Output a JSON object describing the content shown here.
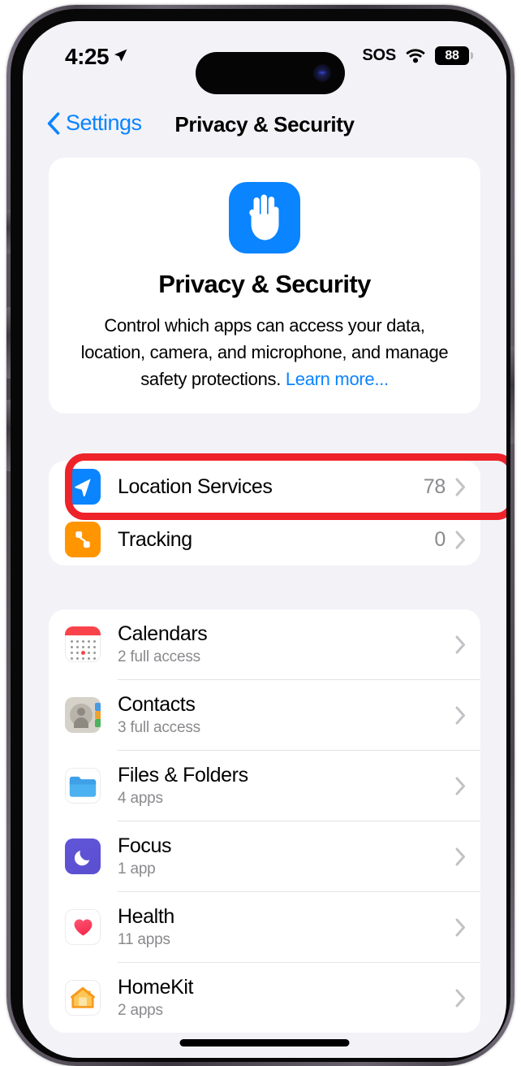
{
  "status_bar": {
    "time": "4:25",
    "location_icon": "location-arrow-icon",
    "sos": "SOS",
    "wifi_icon": "wifi-icon",
    "battery_percent": "88"
  },
  "nav": {
    "back_label": "Settings",
    "back_icon": "chevron-left-icon",
    "title": "Privacy & Security"
  },
  "hero": {
    "icon": "privacy-hand-icon",
    "icon_color": "#0a84ff",
    "title": "Privacy & Security",
    "description": "Control which apps can access your data, location, camera, and microphone, and manage safety protections. ",
    "link_label": "Learn more...",
    "link_color": "#0a84ff"
  },
  "location_section": {
    "rows": [
      {
        "label": "Location Services",
        "value": "78",
        "icon": "location-arrow-icon",
        "icon_color": "#0a84ff",
        "highlighted": true
      },
      {
        "label": "Tracking",
        "value": "0",
        "icon": "tracking-icon",
        "icon_color": "#ff9500",
        "highlighted": false
      }
    ]
  },
  "permissions_section": {
    "rows": [
      {
        "label": "Calendars",
        "sub": "2 full access",
        "icon": "calendar-icon"
      },
      {
        "label": "Contacts",
        "sub": "3 full access",
        "icon": "contacts-icon"
      },
      {
        "label": "Files & Folders",
        "sub": "4 apps",
        "icon": "folder-icon"
      },
      {
        "label": "Focus",
        "sub": "1 app",
        "icon": "moon-icon"
      },
      {
        "label": "Health",
        "sub": "11 apps",
        "icon": "heart-icon"
      },
      {
        "label": "HomeKit",
        "sub": "2 apps",
        "icon": "house-icon"
      }
    ]
  },
  "highlight": {
    "color": "#ee2229"
  }
}
